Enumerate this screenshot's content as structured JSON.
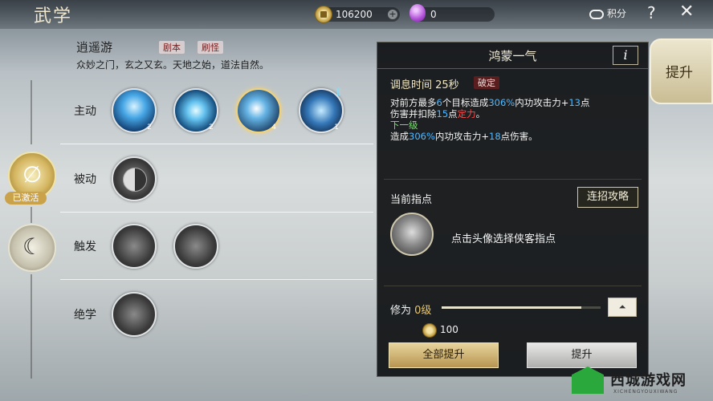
{
  "header": {
    "title": "武学",
    "coins": "106200",
    "gems": "0",
    "score_label": "积分",
    "help": "?",
    "close": "✕"
  },
  "section": {
    "name": "逍遥游",
    "tags": [
      "剧本",
      "刷怪"
    ],
    "description": "众妙之门，玄之又玄。天地之始，道法自然。"
  },
  "rows": [
    {
      "label": "主动",
      "skills": [
        {
          "level": "2"
        },
        {
          "level": "2"
        },
        {
          "level": "4"
        },
        {
          "level": "1"
        }
      ]
    },
    {
      "label": "被动",
      "skills": [
        {
          "level": ""
        }
      ]
    },
    {
      "label": "触发",
      "skills": [
        {
          "level": ""
        },
        {
          "level": ""
        }
      ]
    },
    {
      "label": "绝学",
      "skills": [
        {
          "level": ""
        }
      ]
    }
  ],
  "side_badges": {
    "active_label": "已激活"
  },
  "detail": {
    "title": "鸿蒙一气",
    "info": "i",
    "cooldown": "调息时间 25秒",
    "break_tag": "破定",
    "effect": {
      "line1_a": "对前方最多",
      "line1_b": "6",
      "line1_c": "个目标造成",
      "line1_d": "306%",
      "line1_e": "内功攻击力+",
      "line1_f": "13",
      "line1_g": "点",
      "line2_a": "伤害并扣除",
      "line2_b": "15",
      "line2_c": "点",
      "line2_d": "定力",
      "line2_e": "。",
      "next_level": "下一级",
      "line4_a": "造成",
      "line4_b": "306%",
      "line4_c": "内功攻击力+",
      "line4_d": "18",
      "line4_e": "点伤害。"
    },
    "guide_title": "当前指点",
    "combo_button": "连招攻略",
    "portrait_hint": "点击头像选择侠客指点",
    "cultivation_label": "修为",
    "cultivation_value": "0级",
    "cultivation_progress": 0.88,
    "upgrade_cost": "100",
    "btn_upgrade_all": "全部提升",
    "btn_upgrade": "提升"
  },
  "right_tab": "提升",
  "watermark": {
    "text": "西城游戏网",
    "sub": "XICHENGYOUXIWANG"
  }
}
